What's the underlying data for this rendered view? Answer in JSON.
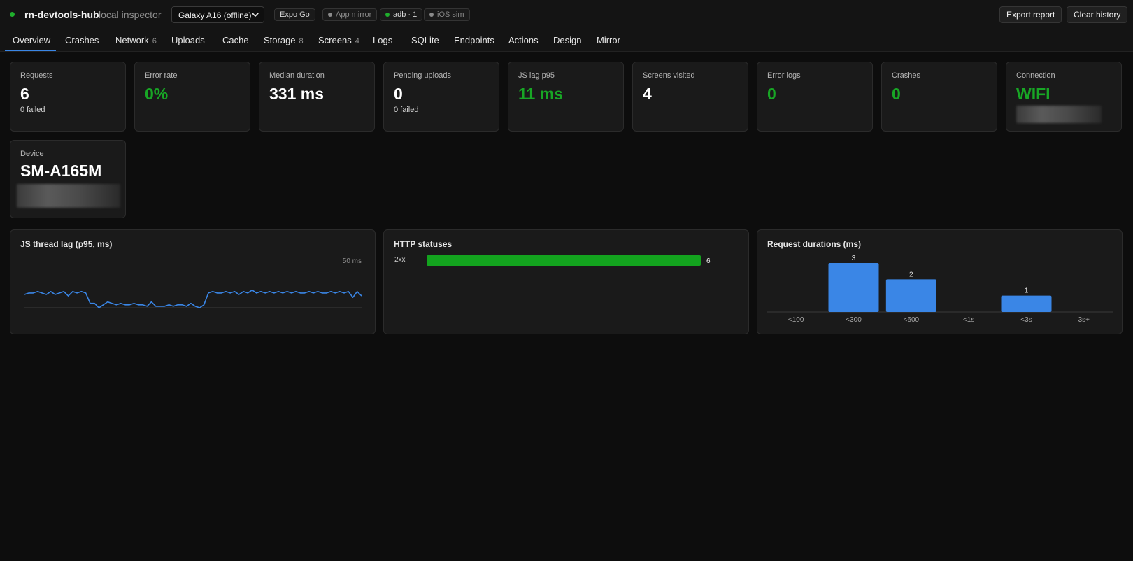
{
  "header": {
    "app_name": "rn-devtools-hub",
    "app_subtitle": "local inspector",
    "device_selected": "Galaxy A16 (offline)",
    "pills": [
      {
        "label": "Expo Go",
        "dot_color": ""
      },
      {
        "label": "App mirror",
        "dot_color": "#8a8a8a"
      },
      {
        "label": "adb · 1",
        "dot_color": "#1fae2c"
      },
      {
        "label": "iOS sim",
        "dot_color": "#8a8a8a"
      }
    ],
    "export_label": "Export report",
    "clear_label": "Clear history",
    "status_color": "#1fae2c"
  },
  "tabs": [
    {
      "label": "Overview",
      "count": ""
    },
    {
      "label": "Crashes",
      "count": ""
    },
    {
      "label": "Network",
      "count": "6"
    },
    {
      "label": "Uploads",
      "count": ""
    },
    {
      "label": "Cache",
      "count": ""
    },
    {
      "label": "Storage",
      "count": "8"
    },
    {
      "label": "Screens",
      "count": "4"
    },
    {
      "label": "Logs",
      "count": ""
    },
    {
      "label": "SQLite",
      "count": ""
    },
    {
      "label": "Endpoints",
      "count": ""
    },
    {
      "label": "Actions",
      "count": ""
    },
    {
      "label": "Design",
      "count": ""
    },
    {
      "label": "Mirror",
      "count": ""
    }
  ],
  "active_tab": "Overview",
  "stats": [
    {
      "label": "Requests",
      "value": "6",
      "sub": "0 failed",
      "color": "#ffffff"
    },
    {
      "label": "Error rate",
      "value": "0%",
      "sub": "",
      "color": "#18a625"
    },
    {
      "label": "Median duration",
      "value": "331 ms",
      "sub": "",
      "color": "#ffffff"
    },
    {
      "label": "Pending uploads",
      "value": "0",
      "sub": "0 failed",
      "color": "#ffffff"
    },
    {
      "label": "JS lag p95",
      "value": "11 ms",
      "sub": "",
      "color": "#18a625"
    },
    {
      "label": "Screens visited",
      "value": "4",
      "sub": "",
      "color": "#ffffff"
    },
    {
      "label": "Error logs",
      "value": "0",
      "sub": "",
      "color": "#18a625"
    },
    {
      "label": "Crashes",
      "value": "0",
      "sub": "",
      "color": "#18a625"
    },
    {
      "label": "Connection",
      "value": "WIFI",
      "sub": "",
      "color": "#18a625"
    }
  ],
  "device_card": {
    "label": "Device",
    "value": "SM-A165M"
  },
  "panels": {
    "js_lag_title": "JS thread lag (p95, ms)",
    "http_title": "HTTP statuses",
    "durations_title": "Request durations (ms)"
  },
  "chart_data": [
    {
      "type": "line",
      "title": "JS thread lag (p95, ms)",
      "ymax_label": "50 ms",
      "ylim": [
        0,
        50
      ],
      "color": "#3a86e6",
      "values": [
        9,
        10,
        10,
        11,
        10,
        9,
        11,
        9,
        10,
        11,
        8,
        11,
        10,
        11,
        10,
        3,
        3,
        0,
        2,
        4,
        3,
        2,
        3,
        2,
        2,
        3,
        2,
        2,
        1,
        4,
        1,
        1,
        1,
        2,
        1,
        2,
        2,
        1,
        3,
        1,
        0,
        2,
        10,
        11,
        10,
        10,
        11,
        10,
        11,
        9,
        11,
        10,
        12,
        10,
        11,
        10,
        11,
        10,
        11,
        10,
        11,
        10,
        11,
        10,
        10,
        11,
        10,
        11,
        10,
        10,
        11,
        10,
        11,
        10,
        11,
        7,
        11,
        8
      ]
    },
    {
      "type": "bar",
      "orientation": "horizontal",
      "title": "HTTP statuses",
      "categories": [
        "2xx"
      ],
      "values": [
        6
      ],
      "xlim": [
        0,
        6
      ],
      "color": "#13a31e"
    },
    {
      "type": "bar",
      "title": "Request durations (ms)",
      "categories": [
        "<100",
        "<300",
        "<600",
        "<1s",
        "<3s",
        "3s+"
      ],
      "values": [
        0,
        3,
        2,
        0,
        1,
        0
      ],
      "ylim": [
        0,
        3
      ],
      "color": "#3a86e6"
    }
  ]
}
